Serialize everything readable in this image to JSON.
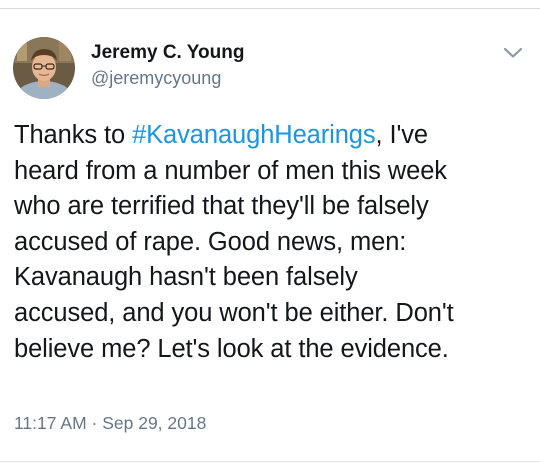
{
  "tweet": {
    "author": {
      "display_name": "Jeremy C. Young",
      "handle": "@jeremycyoung"
    },
    "menu_icon": "chevron-down-icon",
    "text_lines": [
      {
        "before": "Thanks to ",
        "hashtag": "#KavanaughHearings",
        "after": ", I've"
      },
      {
        "text": "heard from a number of men this week"
      },
      {
        "text": "who are terrified that they'll be falsely"
      },
      {
        "text": "accused of rape. Good news, men:"
      },
      {
        "text": "Kavanaugh hasn't been falsely"
      },
      {
        "text": "accused, and you won't be either. Don't"
      },
      {
        "text": "believe me? Let's look at the evidence."
      }
    ],
    "time": "11:17 AM",
    "separator": "·",
    "date": "Sep 29, 2018"
  },
  "colors": {
    "hashtag": "#1b95e0",
    "secondary_text": "#657786",
    "primary_text": "#14171a"
  }
}
